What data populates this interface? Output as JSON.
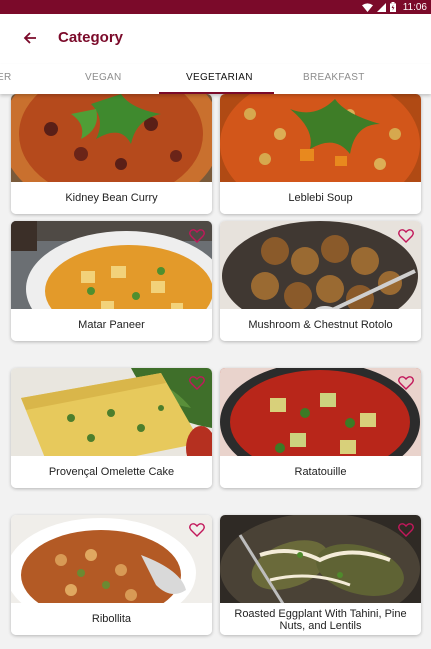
{
  "status": {
    "time": "11:06"
  },
  "appbar": {
    "title": "Category"
  },
  "tabs": [
    {
      "label": "ER"
    },
    {
      "label": "VEGAN"
    },
    {
      "label": "VEGETARIAN"
    },
    {
      "label": "BREAKFAST"
    }
  ],
  "active_tab": "VEGETARIAN",
  "recipes": [
    {
      "name": "Kidney Bean Curry",
      "favorite_icon": "heart-outline-icon"
    },
    {
      "name": "Leblebi Soup",
      "favorite_icon": "heart-outline-icon"
    },
    {
      "name": "Matar Paneer",
      "favorite_icon": "heart-outline-icon"
    },
    {
      "name": "Mushroom & Chestnut Rotolo",
      "favorite_icon": "heart-outline-icon"
    },
    {
      "name": "Provençal Omelette Cake",
      "favorite_icon": "heart-outline-icon"
    },
    {
      "name": "Ratatouille",
      "favorite_icon": "heart-outline-icon"
    },
    {
      "name": "Ribollita",
      "favorite_icon": "heart-outline-icon"
    },
    {
      "name": "Roasted Eggplant With Tahini, Pine Nuts, and Lentils",
      "favorite_icon": "heart-outline-icon"
    }
  ],
  "colors": {
    "primary": "#7b0a2a",
    "heart": "#c2185b",
    "background": "#f2f2f2"
  }
}
